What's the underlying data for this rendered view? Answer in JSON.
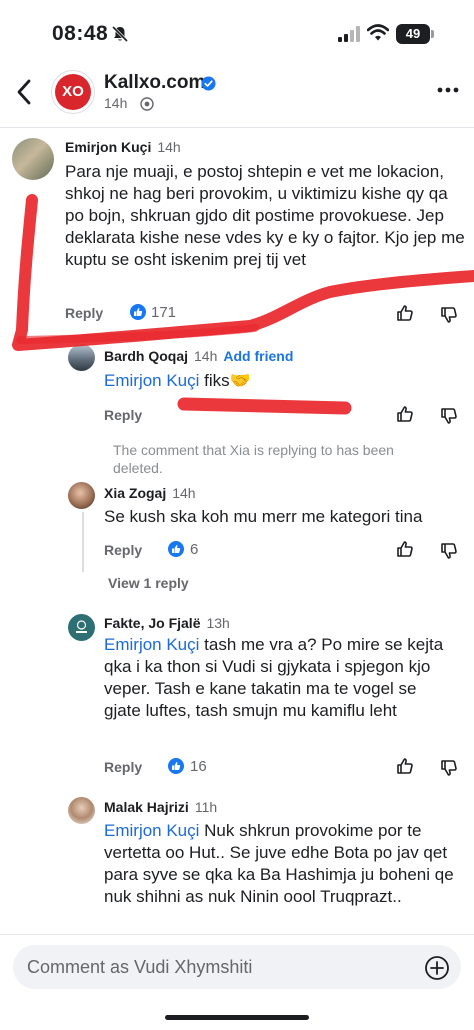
{
  "status_bar": {
    "time": "08:48",
    "battery": "49",
    "battery_level_percent": 49
  },
  "header": {
    "page_name": "Kallxo.com",
    "post_time": "14h",
    "logo_text": "XO"
  },
  "comments": [
    {
      "author": "Emirjon Kuçi",
      "time": "14h",
      "text": "Para nje muaji, e postoj shtepin e vet me lokacion, shkoj ne hag beri provokim, u viktimizu kishe qy qa po bojn, shkruan gjdo dit postime provokuese. Jep deklarata kishe nese vdes ky e ky o fajtor. Kjo jep me kuptu se osht iskenim prej tij vet",
      "reply_label": "Reply",
      "likes": "171"
    },
    {
      "author": "Bardh Qoqaj",
      "time": "14h",
      "add_friend": "Add friend",
      "mention": "Emirjon Kuçi",
      "text": " fiks🤝",
      "reply_label": "Reply"
    },
    {
      "deleted_note": "The comment that Xia is replying to has been deleted."
    },
    {
      "author": "Xia Zogaj",
      "time": "14h",
      "text": "Se kush ska koh mu merr me kategori tina",
      "reply_label": "Reply",
      "likes": "6",
      "view_replies": "View 1 reply"
    },
    {
      "author": "Fakte, Jo Fjalë",
      "time": "13h",
      "mention": "Emirjon Kuçi",
      "text": " tash me vra a? Po mire se kejta qka i ka thon si Vudi si gjykata i spjegon kjo veper. Tash e kane takatin ma te vogel se gjate luftes, tash smujn mu kamiflu leht",
      "reply_label": "Reply",
      "likes": "16"
    },
    {
      "author": "Malak Hajrizi",
      "time": "11h",
      "mention": "Emirjon Kuçi",
      "text": " Nuk shkrun provokime por te vertetta oo Hut.. Se juve edhe Bota po jav qet para syve se qka ka Ba Hashimja ju boheni qe nuk shihni as nuk Ninin  oool Truqprazt.."
    }
  ],
  "composer": {
    "placeholder": "Comment as Vudi Xhymshiti"
  },
  "colors": {
    "accent": "#1877f2",
    "scribble": "#e8272b",
    "brand": "#d9262c"
  },
  "icons": [
    "bell-slash-icon",
    "signal-icon",
    "wifi-icon",
    "back-icon",
    "verified-icon",
    "globe-icon",
    "more-icon",
    "like-icon",
    "thumb-up-icon",
    "thumb-down-icon",
    "add-icon"
  ]
}
